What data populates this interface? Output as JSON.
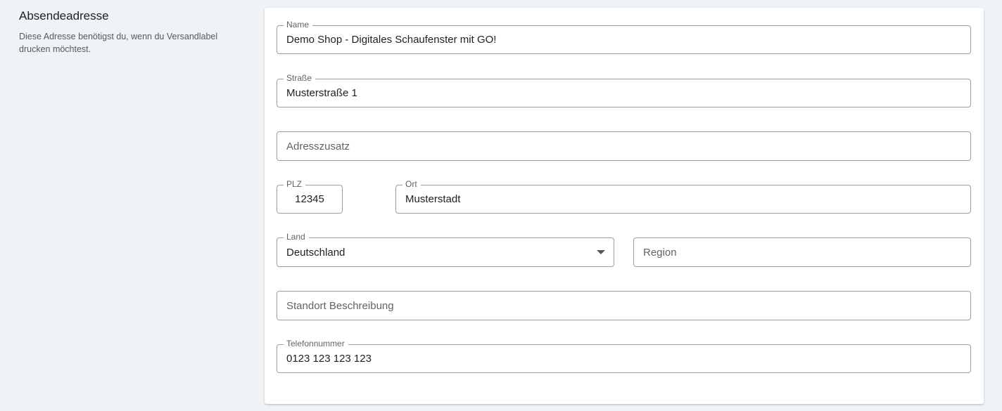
{
  "section": {
    "title": "Absendeadresse",
    "description": "Diese Adresse benötigst du, wenn du Versandlabel drucken möchtest."
  },
  "form": {
    "name": {
      "label": "Name",
      "value": "Demo Shop - Digitales Schaufenster mit GO!"
    },
    "street": {
      "label": "Straße",
      "value": "Musterstraße 1"
    },
    "address_extra": {
      "placeholder": "Adresszusatz"
    },
    "zip": {
      "label": "PLZ",
      "value": "12345"
    },
    "city": {
      "label": "Ort",
      "value": "Musterstadt"
    },
    "country": {
      "label": "Land",
      "value": "Deutschland"
    },
    "region": {
      "placeholder": "Region"
    },
    "location_description": {
      "placeholder": "Standort Beschreibung"
    },
    "phone": {
      "label": "Telefonnummer",
      "value": "0123 123 123 123"
    }
  },
  "icons": {
    "country_dropdown": "chevron-down-icon"
  }
}
